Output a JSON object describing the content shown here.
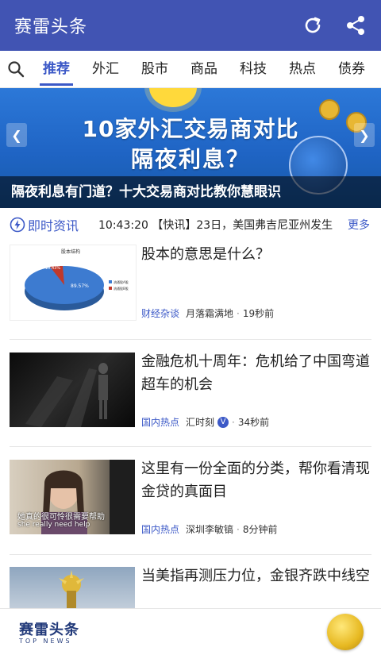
{
  "app": {
    "title": "赛雷头条"
  },
  "tabs": [
    "推荐",
    "外汇",
    "股市",
    "商品",
    "科技",
    "热点",
    "债券"
  ],
  "banner": {
    "headline_line1": "10家外汇交易商对比",
    "headline_line2": "隔夜利息？",
    "caption": "隔夜利息有门道？十大交易商对比教你慧眼识"
  },
  "ticker": {
    "label": "即时资讯",
    "text": "10:43:20 【快讯】23日，美国弗吉尼亚州发生",
    "more": "更多"
  },
  "news": [
    {
      "headline": "股本的意思是什么？",
      "category": "财经杂谈",
      "author": "月落霜满地",
      "time": "19秒前",
      "thumb": {
        "type": "pie-chart",
        "title": "股本结构",
        "big_label": "89.57%",
        "small_label": "10.43%",
        "legend": [
          "流通股A股",
          "流通股B股"
        ]
      }
    },
    {
      "headline": "金融危机十周年：危机给了中国弯道超车的机会",
      "category": "国内热点",
      "author": "汇时刻",
      "verified": "V",
      "time": "34秒前",
      "thumb": {
        "type": "dark-photo"
      }
    },
    {
      "headline": "这里有一份全面的分类，帮你看清现金贷的真面目",
      "category": "国内热点",
      "author": "深圳李敏镐",
      "time": "8分钟前",
      "thumb": {
        "type": "portrait",
        "sub_cn": "她真的很可怜很需要帮助",
        "sub_en": "she really need help"
      }
    },
    {
      "headline": "当美指再测压力位，金银齐跌中线空",
      "thumb": {
        "type": "statue"
      }
    }
  ],
  "bottom": {
    "logo_main": "赛雷头条",
    "logo_sub": "TOP NEWS"
  },
  "colors": {
    "primary": "#4154b3",
    "accent": "#3c59c7"
  }
}
